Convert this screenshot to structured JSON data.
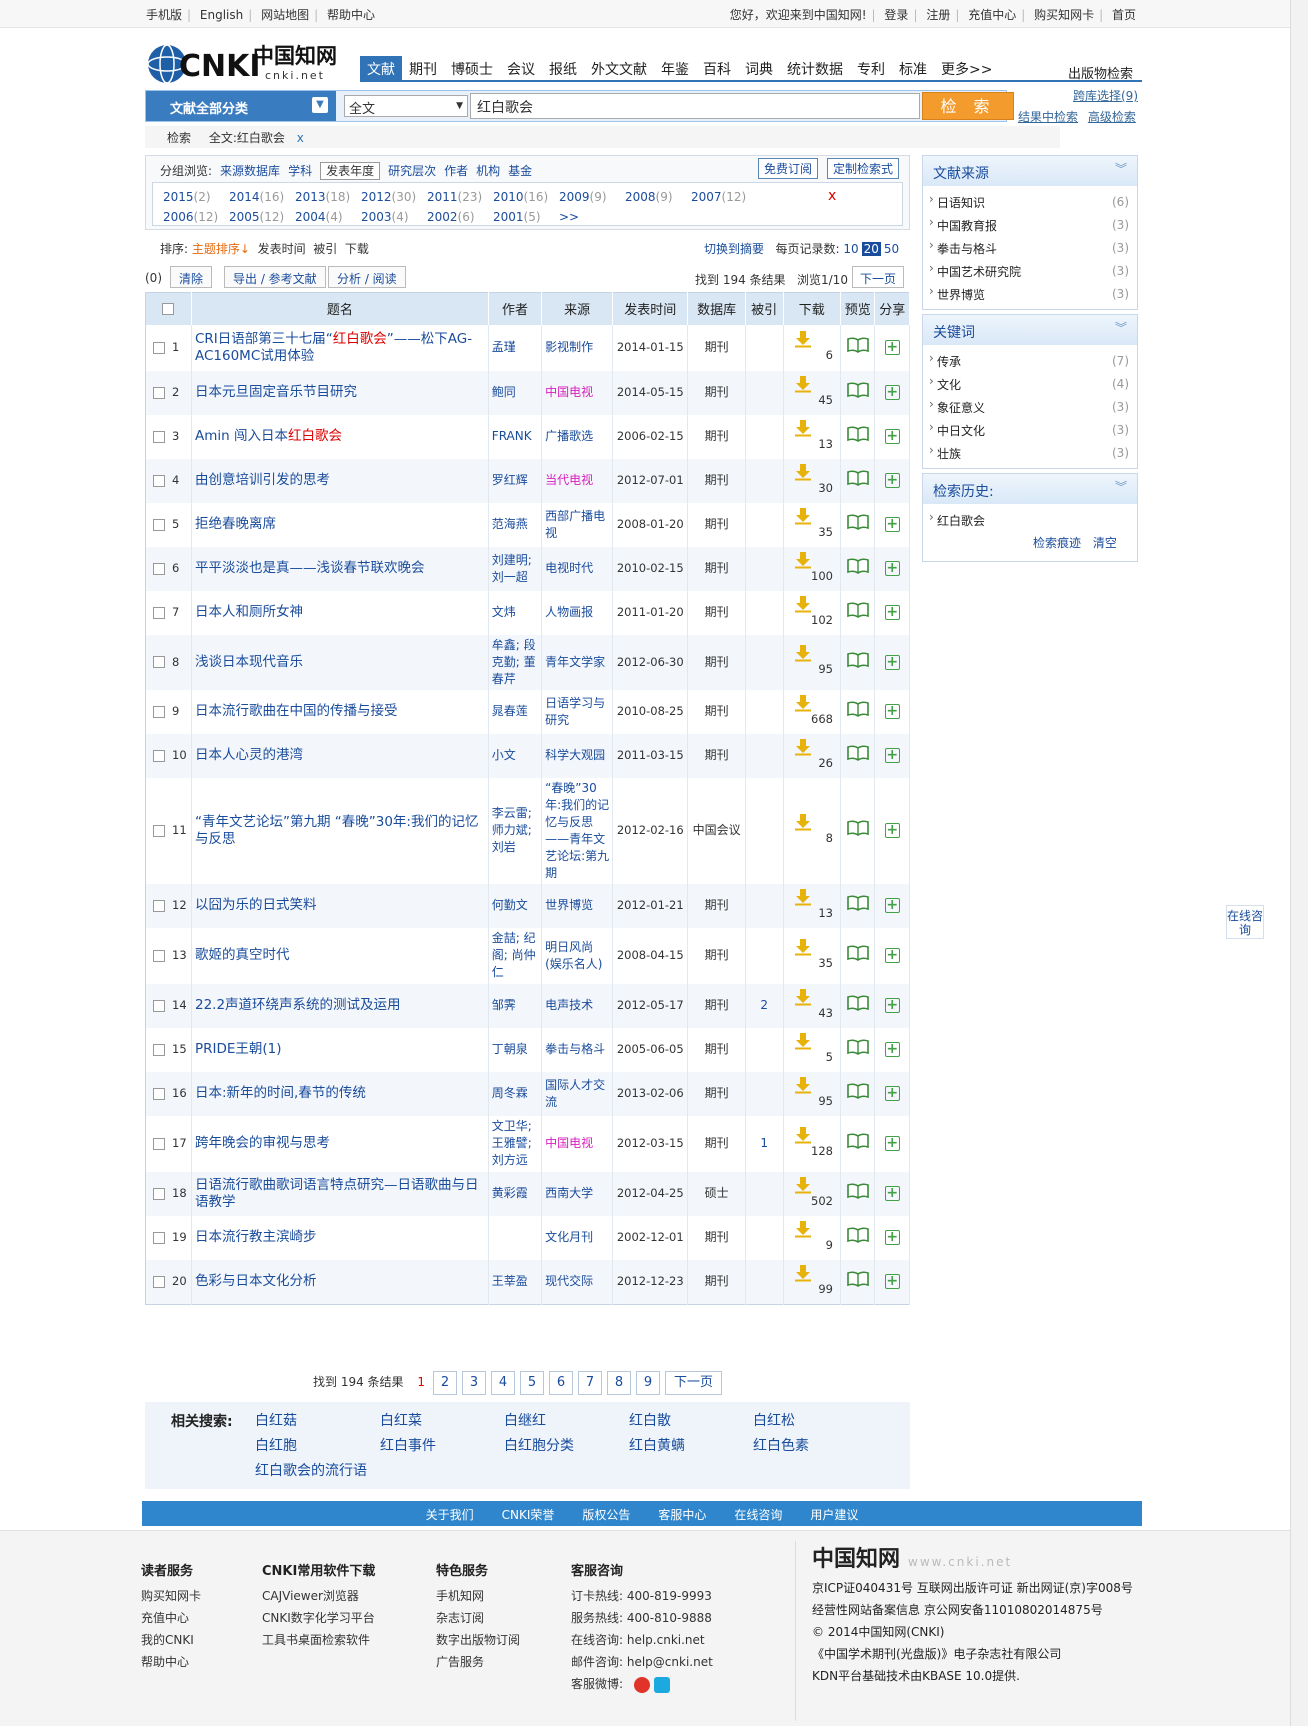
{
  "topbar": {
    "mobile": "手机版",
    "english": "English",
    "sitemap": "网站地图",
    "help": "帮助中心",
    "welcome": "您好，欢迎来到中国知网!",
    "login": "登录",
    "register": "注册",
    "recharge": "充值中心",
    "buycard": "购买知网卡",
    "home": "首页"
  },
  "logo": {
    "brand": "CNKI",
    "cn": "中国知网",
    "url": "cnki.net"
  },
  "nav": [
    "文献",
    "期刊",
    "博硕士",
    "会议",
    "报纸",
    "外文文献",
    "年鉴",
    "百科",
    "词典",
    "统计数据",
    "专利",
    "标准",
    "更多>>"
  ],
  "nav_active": "文献",
  "pubsearch": "出版物检索",
  "search": {
    "category": "文献全部分类",
    "field": "全文",
    "query": "红白歌会",
    "button": "检 索",
    "cross_db": "跨库选择(9)",
    "in_result": "结果中检索",
    "advanced": "高级检索"
  },
  "crumb": {
    "label": "检索",
    "item": "全文:红白歌会",
    "close": "x"
  },
  "filter": {
    "label": "分组浏览:",
    "groups": [
      "来源数据库",
      "学科",
      "发表年度",
      "研究层次",
      "作者",
      "机构",
      "基金"
    ],
    "selected": "发表年度",
    "free_sub": "免费订阅",
    "custom": "定制检索式",
    "years_row1": [
      [
        "2015",
        "(2)"
      ],
      [
        "2014",
        "(16)"
      ],
      [
        "2013",
        "(18)"
      ],
      [
        "2012",
        "(30)"
      ],
      [
        "2011",
        "(23)"
      ],
      [
        "2010",
        "(16)"
      ],
      [
        "2009",
        "(9)"
      ],
      [
        "2008",
        "(9)"
      ],
      [
        "2007",
        "(12)"
      ]
    ],
    "years_row2": [
      [
        "2006",
        "(12)"
      ],
      [
        "2005",
        "(12)"
      ],
      [
        "2004",
        "(4)"
      ],
      [
        "2003",
        "(4)"
      ],
      [
        "2002",
        "(6)"
      ],
      [
        "2001",
        "(5)"
      ],
      [
        ">>",
        ""
      ]
    ],
    "close": "x"
  },
  "sort": {
    "label": "排序:",
    "theme": "主题排序",
    "time": "发表时间",
    "cited": "被引",
    "download": "下载",
    "switch": "切换到摘要",
    "per_page": "每页记录数:",
    "opts": [
      "10",
      "20",
      "50"
    ],
    "current": "20"
  },
  "ops": {
    "count": "(0)",
    "clear": "清除",
    "export": "导出 / 参考文献",
    "analyze": "分析 / 阅读",
    "found": "找到 194 条结果",
    "browse": "浏览1/10",
    "next": "下一页"
  },
  "table": {
    "headers": [
      "题名",
      "作者",
      "来源",
      "发表时间",
      "数据库",
      "被引",
      "下载",
      "预览",
      "分享"
    ],
    "rows": [
      {
        "n": "1",
        "title_parts": [
          "CRI日语部第三十七届“",
          "红白歌会",
          "”——松下AG-AC160MC试用体验"
        ],
        "author": "孟瑾",
        "source": "影视制作",
        "pink": false,
        "date": "2014-01-15",
        "db": "期刊",
        "cited": "",
        "dl": "6"
      },
      {
        "n": "2",
        "title_parts": [
          "日本元旦固定音乐节目研究",
          "",
          ""
        ],
        "author": "鲍同",
        "source": "中国电视",
        "pink": true,
        "date": "2014-05-15",
        "db": "期刊",
        "cited": "",
        "dl": "45"
      },
      {
        "n": "3",
        "title_parts": [
          "Amin 闯入日本",
          "红白歌会",
          ""
        ],
        "author": "FRANK",
        "source": "广播歌选",
        "pink": false,
        "date": "2006-02-15",
        "db": "期刊",
        "cited": "",
        "dl": "13"
      },
      {
        "n": "4",
        "title_parts": [
          "由创意培训引发的思考",
          "",
          ""
        ],
        "author": "罗红辉",
        "source": "当代电视",
        "pink": true,
        "date": "2012-07-01",
        "db": "期刊",
        "cited": "",
        "dl": "30"
      },
      {
        "n": "5",
        "title_parts": [
          "拒绝春晚离席",
          "",
          ""
        ],
        "author": "范海燕",
        "source": "西部广播电视",
        "pink": false,
        "date": "2008-01-20",
        "db": "期刊",
        "cited": "",
        "dl": "35"
      },
      {
        "n": "6",
        "title_parts": [
          "平平淡淡也是真——浅谈春节联欢晚会",
          "",
          ""
        ],
        "author": "刘建明; 刘一超",
        "source": "电视时代",
        "pink": false,
        "date": "2010-02-15",
        "db": "期刊",
        "cited": "",
        "dl": "100"
      },
      {
        "n": "7",
        "title_parts": [
          "日本人和厕所女神",
          "",
          ""
        ],
        "author": "文炜",
        "source": "人物画报",
        "pink": false,
        "date": "2011-01-20",
        "db": "期刊",
        "cited": "",
        "dl": "102"
      },
      {
        "n": "8",
        "title_parts": [
          "浅谈日本现代音乐",
          "",
          ""
        ],
        "author": "牟鑫; 段克勤; 董春芹",
        "source": "青年文学家",
        "pink": false,
        "date": "2012-06-30",
        "db": "期刊",
        "cited": "",
        "dl": "95"
      },
      {
        "n": "9",
        "title_parts": [
          "日本流行歌曲在中国的传播与接受",
          "",
          ""
        ],
        "author": "晁春莲",
        "source": "日语学习与研究",
        "pink": false,
        "date": "2010-08-25",
        "db": "期刊",
        "cited": "",
        "dl": "668"
      },
      {
        "n": "10",
        "title_parts": [
          "日本人心灵的港湾",
          "",
          ""
        ],
        "author": "小文",
        "source": "科学大观园",
        "pink": false,
        "date": "2011-03-15",
        "db": "期刊",
        "cited": "",
        "dl": "26"
      },
      {
        "n": "11",
        "title_parts": [
          "“青年文艺论坛”第九期 “春晚”30年:我们的记忆与反思",
          "",
          ""
        ],
        "author": "李云雷; 师力斌; 刘岩",
        "source": "“春晚”30年:我们的记忆与反思——青年文艺论坛:第九期",
        "pink": false,
        "date": "2012-02-16",
        "db": "中国会议",
        "cited": "",
        "dl": "8"
      },
      {
        "n": "12",
        "title_parts": [
          "以囧为乐的日式笑料",
          "",
          ""
        ],
        "author": "何勤文",
        "source": "世界博览",
        "pink": false,
        "date": "2012-01-21",
        "db": "期刊",
        "cited": "",
        "dl": "13"
      },
      {
        "n": "13",
        "title_parts": [
          "歌姬的真空时代",
          "",
          ""
        ],
        "author": "金喆; 纪阁; 尚仲仁",
        "source": "明日风尚(娱乐名人)",
        "pink": false,
        "date": "2008-04-15",
        "db": "期刊",
        "cited": "",
        "dl": "35"
      },
      {
        "n": "14",
        "title_parts": [
          "22.2声道环绕声系统的测试及运用",
          "",
          ""
        ],
        "author": "邹霁",
        "source": "电声技术",
        "pink": false,
        "date": "2012-05-17",
        "db": "期刊",
        "cited": "2",
        "dl": "43"
      },
      {
        "n": "15",
        "title_parts": [
          "PRIDE王朝(1)",
          "",
          ""
        ],
        "author": "丁朝泉",
        "source": "拳击与格斗",
        "pink": false,
        "date": "2005-06-05",
        "db": "期刊",
        "cited": "",
        "dl": "5"
      },
      {
        "n": "16",
        "title_parts": [
          "日本:新年的时间,春节的传统",
          "",
          ""
        ],
        "author": "周冬霖",
        "source": "国际人才交流",
        "pink": false,
        "date": "2013-02-06",
        "db": "期刊",
        "cited": "",
        "dl": "95"
      },
      {
        "n": "17",
        "title_parts": [
          "跨年晚会的审视与思考",
          "",
          ""
        ],
        "author": "文卫华; 王雅譬; 刘方远",
        "source": "中国电视",
        "pink": true,
        "date": "2012-03-15",
        "db": "期刊",
        "cited": "1",
        "dl": "128"
      },
      {
        "n": "18",
        "title_parts": [
          "日语流行歌曲歌词语言特点研究—日语歌曲与日语教学",
          "",
          ""
        ],
        "author": "黄彩霞",
        "source": "西南大学",
        "pink": false,
        "date": "2012-04-25",
        "db": "硕士",
        "cited": "",
        "dl": "502"
      },
      {
        "n": "19",
        "title_parts": [
          "日本流行教主滨崎步",
          "",
          ""
        ],
        "author": "",
        "source": "文化月刊",
        "pink": false,
        "date": "2002-12-01",
        "db": "期刊",
        "cited": "",
        "dl": "9"
      },
      {
        "n": "20",
        "title_parts": [
          "色彩与日本文化分析",
          "",
          ""
        ],
        "author": "王莘盈",
        "source": "现代交际",
        "pink": false,
        "date": "2012-12-23",
        "db": "期刊",
        "cited": "",
        "dl": "99"
      }
    ]
  },
  "pager": {
    "found": "找到 194 条结果",
    "current": "1",
    "pages": [
      "2",
      "3",
      "4",
      "5",
      "6",
      "7",
      "8",
      "9"
    ],
    "next": "下一页"
  },
  "related": {
    "label": "相关搜索:",
    "items": [
      "白红菇",
      "白红菜",
      "白继红",
      "红白散",
      "白红松",
      "白红胞",
      "红白事件",
      "白红胞分类",
      "红白黄螨",
      "红白色素",
      "红白歌会的流行语"
    ]
  },
  "right": {
    "sources": {
      "title": "文献来源",
      "items": [
        [
          "日语知识",
          "(6)"
        ],
        [
          "中国教育报",
          "(3)"
        ],
        [
          "拳击与格斗",
          "(3)"
        ],
        [
          "中国艺术研究院",
          "(3)"
        ],
        [
          "世界博览",
          "(3)"
        ]
      ]
    },
    "keywords": {
      "title": "关键词",
      "items": [
        [
          "传承",
          "(7)"
        ],
        [
          "文化",
          "(4)"
        ],
        [
          "象征意义",
          "(3)"
        ],
        [
          "中日文化",
          "(3)"
        ],
        [
          "壮族",
          "(3)"
        ]
      ]
    },
    "history": {
      "title": "检索历史:",
      "items": [
        "红白歌会"
      ],
      "trace": "检索痕迹",
      "clear": "清空"
    }
  },
  "online": "在线咨询",
  "footnav": [
    "关于我们",
    "CNKI荣誉",
    "版权公告",
    "客服中心",
    "在线咨询",
    "用户建议"
  ],
  "footer": {
    "col1": {
      "title": "读者服务",
      "items": [
        "购买知网卡",
        "充值中心",
        "我的CNKI",
        "帮助中心"
      ]
    },
    "col2": {
      "title": "CNKI常用软件下载",
      "items": [
        "CAJViewer浏览器",
        "CNKI数字化学习平台",
        "工具书桌面检索软件"
      ]
    },
    "col3": {
      "title": "特色服务",
      "items": [
        "手机知网",
        "杂志订阅",
        "数字出版物订阅",
        "广告服务"
      ]
    },
    "col4": {
      "title": "客服咨询",
      "items": [
        "订卡热线: 400-819-9993",
        "服务热线: 400-810-9888",
        "在线咨询: help.cnki.net",
        "邮件咨询: help@cnki.net",
        "客服微博:"
      ]
    },
    "brand": "中国知网",
    "url": "www.cnki.net",
    "lines": [
      "京ICP证040431号  互联网出版许可证  新出网证(京)字008号",
      "经营性网站备案信息  京公网安备11010802014875号",
      "© 2014中国知网(CNKI)",
      "《中国学术期刊(光盘版)》电子杂志社有限公司",
      "KDN平台基础技术由KBASE 10.0提供."
    ]
  },
  "colors": {
    "accent": "#3173b7",
    "link": "#1a4c9c",
    "highlight": "#dd0000",
    "search_btn": "#f39b2c",
    "download": "#e8b20c",
    "share": "#43a047"
  }
}
